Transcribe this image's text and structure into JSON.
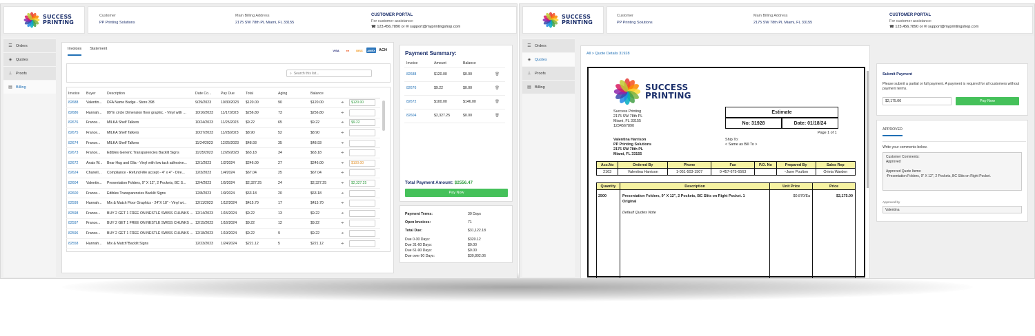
{
  "brand": {
    "line1": "SUCCESS",
    "line2": "PRINTING"
  },
  "header": {
    "customer_label": "Customer",
    "customer_value": "PP Printing Solutions",
    "address_label": "Main Billing Address",
    "address_value": "2175 SW 78th PL Miami, FL 33155",
    "portal_title": "CUSTOMER PORTAL",
    "portal_assist": "For customer assistance:",
    "portal_phone": "123.456.7890",
    "portal_or": "or",
    "portal_email": "support@myprintingshop.com"
  },
  "sidebar": {
    "items": [
      {
        "label": "Orders",
        "icon": "layers-icon"
      },
      {
        "label": "Quotes",
        "icon": "tag-icon"
      },
      {
        "label": "Proofs",
        "icon": "stamp-icon"
      },
      {
        "label": "Billing",
        "icon": "billing-icon"
      }
    ]
  },
  "billing": {
    "tabs": [
      "Invoices",
      "Statement"
    ],
    "cards": [
      "VISA",
      "MC",
      "DISC",
      "AMEX",
      "ACH"
    ],
    "search_placeholder": "Search this list...",
    "columns": [
      "Invoice",
      "Buyer",
      "Description",
      "Date Co...",
      "Pay Due",
      "Total",
      "Aging",
      "Balance"
    ],
    "rows": [
      [
        "82688",
        "Valentin...",
        "DFA Name Badge - Store 398",
        "9/29/2023",
        "10/30/2023",
        "$120.00",
        "90",
        "$120.00",
        "$120.00"
      ],
      [
        "82686",
        "Hannah...",
        "89\"in circle Dimension floor graphic. - Vinyl with ...",
        "10/16/2023",
        "11/17/2023",
        "$256.80",
        "73",
        "$256.80",
        ""
      ],
      [
        "82676",
        "France...",
        "MILKA Shelf Talkers",
        "10/24/2023",
        "11/25/2023",
        "$9.22",
        "65",
        "$9.22",
        "$9.22"
      ],
      [
        "82675",
        "France...",
        "MILKA Shelf Talkers",
        "10/27/2023",
        "11/28/2023",
        "$8.90",
        "52",
        "$8.90",
        ""
      ],
      [
        "82674",
        "France...",
        "MILKA Shelf Talkers",
        "11/24/2023",
        "12/25/2023",
        "$48.93",
        "35",
        "$48.93",
        ""
      ],
      [
        "82673",
        "France...",
        "Edibles Generic Transparencies Backlit Signs",
        "11/25/2023",
        "12/26/2023",
        "$63.18",
        "34",
        "$63.18",
        ""
      ],
      [
        "82672",
        "Anais W...",
        "Bear Hug and Glia - Vinyl with low tack adhesive...",
        "12/1/2023",
        "1/2/2024",
        "$246.00",
        "27",
        "$246.00",
        "$100.00"
      ],
      [
        "82624",
        "Chanell...",
        "Compliance - Refund-We accept - 4\" x 4\" - Dire...",
        "12/3/2023",
        "1/4/2024",
        "$67.04",
        "25",
        "$67.04",
        ""
      ],
      [
        "82604",
        "Valentin...",
        "Presentation Folders, 9\" X 12\", 2 Pockets, BC S...",
        "12/4/2023",
        "1/5/2024",
        "$2,327.25",
        "24",
        "$2,327.25",
        "$2,327.25"
      ],
      [
        "82600",
        "France...",
        "Edibles Transparencies Backlit Signs",
        "12/8/2023",
        "1/9/2024",
        "$63.18",
        "20",
        "$63.18",
        ""
      ],
      [
        "82599",
        "Hannah...",
        "Mix & Match Floor Graphics - 24\"X 18\" - Vinyl wi...",
        "12/11/2023",
        "1/12/2024",
        "$415.70",
        "17",
        "$415.70",
        ""
      ],
      [
        "82598",
        "France...",
        "BUY 2 GET 1 FREE ON NESTLE SWISS CHUNKS ...",
        "12/14/2023",
        "1/15/2024",
        "$9.22",
        "13",
        "$9.22",
        ""
      ],
      [
        "82597",
        "France...",
        "BUY 2 GET 1 FREE ON NESTLE SWISS CHUNKS ...",
        "12/15/2023",
        "1/16/2024",
        "$9.22",
        "12",
        "$9.22",
        ""
      ],
      [
        "82596",
        "France...",
        "BUY 2 GET 1 FREE ON NESTLE SWISS CHUNKS ...",
        "12/18/2023",
        "1/19/2024",
        "$9.22",
        "9",
        "$9.22",
        ""
      ],
      [
        "82558",
        "Hannah...",
        "Mix & Match\"Backlit Signs",
        "12/23/2023",
        "1/24/2024",
        "$221.12",
        "5",
        "$221.12",
        ""
      ]
    ],
    "arrow": "➔"
  },
  "summary": {
    "title": "Payment Summary:",
    "columns": [
      "Invoice",
      "Amount",
      "Balance"
    ],
    "rows": [
      [
        "82688",
        "$120.00",
        "$0.00"
      ],
      [
        "82676",
        "$9.22",
        "$0.00"
      ],
      [
        "82672",
        "$100.00",
        "$146.00"
      ],
      [
        "82604",
        "$2,327.25",
        "$0.00"
      ]
    ],
    "total_label": "Total Payment Amount:",
    "total_value": "$2556.47",
    "pay_now": "Pay Now",
    "terms": [
      [
        "Payment Terms:",
        "30 Days"
      ],
      [
        "Open Invoices:",
        "71"
      ],
      [
        "Total Due:",
        "$31,122.18"
      ]
    ],
    "aging": [
      [
        "Due 0-30 Days:",
        "$320.12"
      ],
      [
        "Due 31-60 Days:",
        "$0.00"
      ],
      [
        "Due 61-90 Days:",
        "$0.00"
      ],
      [
        "Due over 90 Days:",
        "$30,802.06"
      ]
    ]
  },
  "quote": {
    "breadcrumb": "All > Quote Details 31928",
    "company": [
      "Success Printing",
      "2175 SW 78th PL",
      "Miami, FL 33155",
      "1234567890"
    ],
    "estimate_title": "Estimate",
    "estimate_no": "No: 31928",
    "estimate_date": "Date: 01/18/24",
    "page": "Page 1 of 1",
    "billto": [
      "Valentina Harrison",
      "PP Printing Solutions",
      "2175 SW 78th PL",
      "Miami, FL 33155"
    ],
    "shipto": [
      "Ship To:",
      "< Same as Bill To >"
    ],
    "order_cols": [
      "Acc.No",
      "Ordered By",
      "Phone",
      "Fax",
      "P.O. No",
      "Prepared By",
      "Sales Rep"
    ],
    "order_row": [
      "2163",
      "Valentina Harrison",
      "1-051-503-1507",
      "0-457-675-6563",
      "",
      "~June Poulton",
      "Orieta Warden"
    ],
    "item_cols": [
      "Quantity",
      "Description",
      "Unit Price",
      "Price"
    ],
    "item": {
      "qty": "2500",
      "desc1": "Presentation Folders, 9\" X 12\", 2 Pockets, BC Slits on Right Pocket.  1",
      "desc2": "Original",
      "note": "Default Quotes Note",
      "unit": "$0.870/Ea",
      "price": "$2,175.00"
    }
  },
  "submit": {
    "title": "Submit Payment",
    "desc": "Please submit a partial or full payment. A payment is required for all customers without payment terms.",
    "amount": "$2,175.00",
    "pay_now": "Pay Now",
    "status_tab": "APPROVED",
    "comments_label": "Write your comments below.",
    "comments": [
      "Customer Comments:",
      "Approved",
      "",
      "Approved Quote Items:",
      "-Presentation Folders, 9\" X 12\", 2 Pockets, BC Slits on Right Pocket."
    ],
    "approved_by_label": "Approved by",
    "approved_by": "Valentina"
  },
  "colors": {
    "accent": "#1f6fb5",
    "green": "#45c15a",
    "navy": "#1b2f6b",
    "yellow": "#f7f3a2"
  }
}
